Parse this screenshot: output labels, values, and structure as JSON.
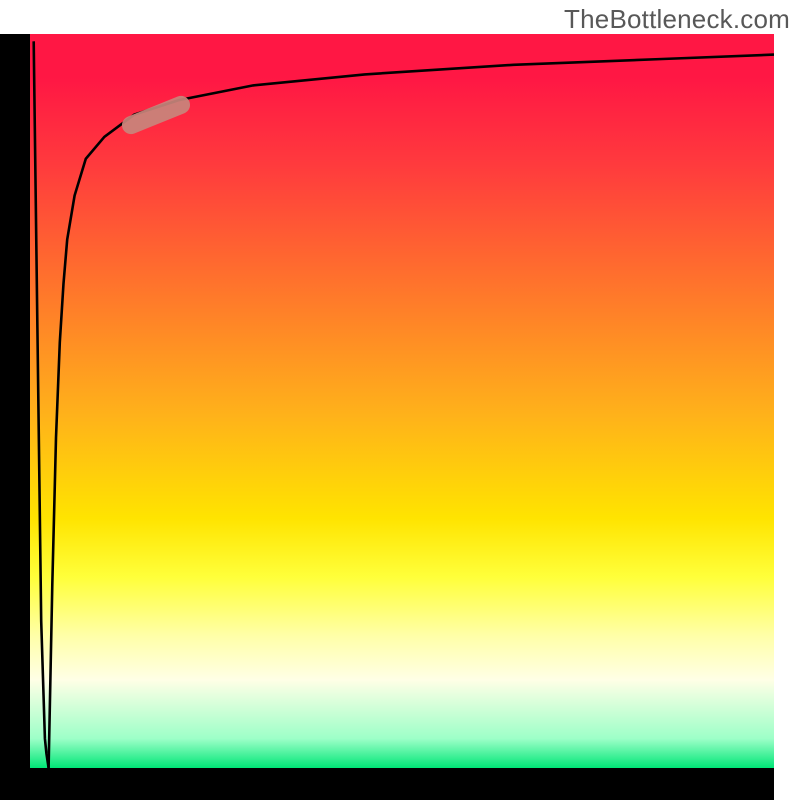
{
  "site_watermark": "TheBottleneck.com",
  "chart_data": {
    "type": "line",
    "title": "",
    "xlabel": "",
    "ylabel": "",
    "x_range": [
      0,
      100
    ],
    "y_range": [
      0,
      100
    ],
    "grid": false,
    "legend": null,
    "background_gradient": {
      "direction": "vertical",
      "stops": [
        {
          "pos": 0.0,
          "color": "#ff1744"
        },
        {
          "pos": 0.36,
          "color": "#ff7a2a"
        },
        {
          "pos": 0.66,
          "color": "#ffe400"
        },
        {
          "pos": 0.88,
          "color": "#ffffe6"
        },
        {
          "pos": 1.0,
          "color": "#00e676"
        }
      ]
    },
    "series": [
      {
        "name": "dip-spike",
        "color": "#000000",
        "x": [
          0.5,
          1.0,
          1.5,
          2.0,
          2.2,
          2.5
        ],
        "y": [
          99,
          60,
          20,
          4,
          2,
          0
        ]
      },
      {
        "name": "recovery-curve",
        "color": "#000000",
        "x": [
          2.5,
          3.0,
          3.5,
          4.0,
          4.5,
          5.0,
          6.0,
          7.5,
          10,
          14,
          20,
          30,
          45,
          65,
          85,
          100
        ],
        "y": [
          0,
          25,
          45,
          58,
          66,
          72,
          78,
          83,
          86,
          89,
          91,
          93,
          94.5,
          95.8,
          96.6,
          97.2
        ]
      }
    ],
    "marker": {
      "name": "highlight-segment",
      "color": "#c8867c",
      "x_center": 17,
      "y_center": 89,
      "rotation_deg": -22
    }
  }
}
